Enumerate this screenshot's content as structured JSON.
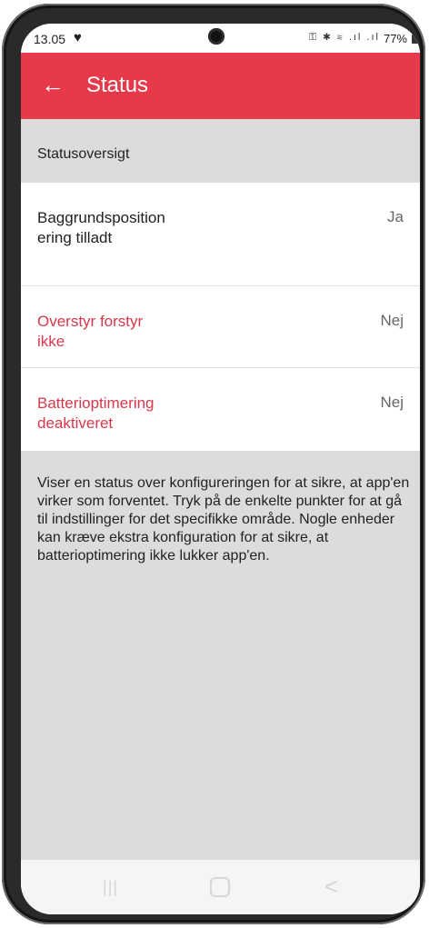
{
  "status_bar": {
    "time": "13.05",
    "heart_icon": "♥",
    "icons": "⚿ ✱ ≋ .ıl .ıl",
    "battery": "77%"
  },
  "app_bar": {
    "back_icon": "←",
    "title": "Status"
  },
  "section": {
    "header": "Statusoversigt"
  },
  "rows": [
    {
      "label": "Baggrundspositionering tilladt",
      "value": "Ja",
      "status_color": "#222222"
    },
    {
      "label": "Overstyr forstyr ikke",
      "value": "Nej",
      "status_color": "#d8384a"
    },
    {
      "label": "Batterioptimering deaktiveret",
      "value": "Nej",
      "status_color": "#d8384a"
    }
  ],
  "description": "Viser en status over konfigureringen for at sikre, at app'en virker som forventet. Tryk på de enkelte punkter for at gå til indstillinger for det specifikke område. Nogle enheder kan kræve ekstra konfiguration for at sikre, at batterioptimering ikke lukker app'en.",
  "nav": {
    "recent_icon": "|||",
    "back_icon": "<"
  },
  "colors": {
    "accent": "#e8394a",
    "warning_text": "#d8384a",
    "section_bg": "#dcdcdc"
  }
}
